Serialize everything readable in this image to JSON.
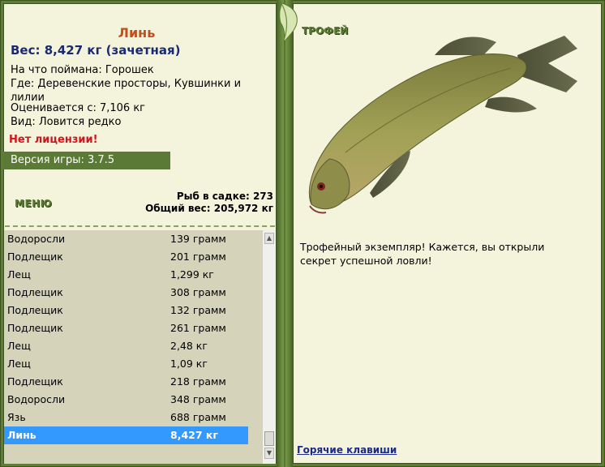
{
  "fish": {
    "name": "Линь",
    "weight_line": "Вес: 8,427 кг (зачетная)",
    "bait_line": "На что поймана: Горошек",
    "where_line": "Где: Деревенские просторы, Кувшинки и лилии",
    "valued_line": "Оценивается с: 7,106 кг",
    "kind_line": "Вид: Ловится редко"
  },
  "license_warning": "Нет лицензии!",
  "version_label": "Версия игры: 3.7.5",
  "menu_title": "МЕНЮ",
  "keep": {
    "count_line": "Рыб в садке: 273",
    "total_line": "Общий вес: 205,972 кг"
  },
  "catch_list": [
    {
      "name": "Водоросли",
      "weight": "139 грамм"
    },
    {
      "name": "Подлещик",
      "weight": "201 грамм"
    },
    {
      "name": "Лещ",
      "weight": "1,299 кг"
    },
    {
      "name": "Подлещик",
      "weight": "308 грамм"
    },
    {
      "name": "Подлещик",
      "weight": "132 грамм"
    },
    {
      "name": "Подлещик",
      "weight": "261 грамм"
    },
    {
      "name": "Лещ",
      "weight": "2,48 кг"
    },
    {
      "name": "Лещ",
      "weight": "1,09 кг"
    },
    {
      "name": "Подлещик",
      "weight": "218 грамм"
    },
    {
      "name": "Водоросли",
      "weight": "348 грамм"
    },
    {
      "name": "Язь",
      "weight": "688 грамм"
    },
    {
      "name": "Линь",
      "weight": "8,427 кг",
      "selected": true
    }
  ],
  "trophy": {
    "title": "ТРОФЕЙ",
    "text": "Трофейный экземпляр! Кажется, вы открыли секрет успешной ловли!"
  },
  "hotkeys_link": "Горячие клавиши",
  "colors": {
    "frame_green": "#5f7d37",
    "panel_bg": "#f4f3dc",
    "name_orange": "#c0501f",
    "weight_navy": "#1b2a6e",
    "warning_red": "#d0161b",
    "selection_blue": "#3399ff",
    "list_bg": "#d5d4ba"
  },
  "icons": {
    "leaf": "leaf-decoration-icon",
    "scroll_up": "scroll-up-arrow-icon",
    "scroll_down": "scroll-down-arrow-icon"
  }
}
